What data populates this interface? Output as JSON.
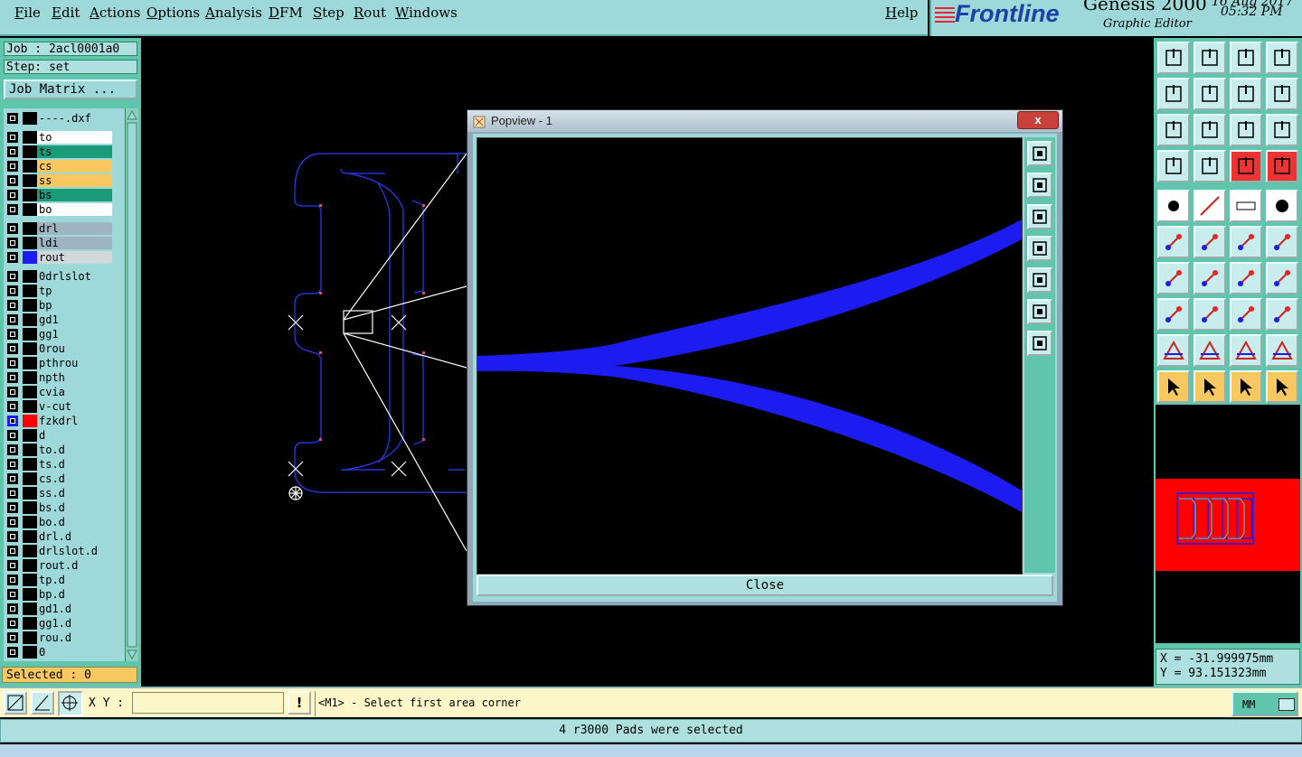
{
  "menu": {
    "items": [
      "File",
      "Edit",
      "Actions",
      "Options",
      "Analysis",
      "DFM",
      "Step",
      "Rout",
      "Windows"
    ],
    "help": "Help"
  },
  "brand": {
    "logo": "Frontline",
    "product": "Genesis 2000",
    "subtitle": "Graphic Editor",
    "date": "16 Aug 2017",
    "time": "05:32 PM"
  },
  "left": {
    "job": "Job : 2acl0001a0",
    "step": "Step: set",
    "job_matrix": "Job Matrix ...",
    "selected": "Selected : 0",
    "layers": [
      {
        "name": "----.dxf",
        "color": "#9fd8d8"
      },
      {
        "name": "to",
        "color": "#ffffff"
      },
      {
        "name": "ts",
        "color": "#1a9b7a"
      },
      {
        "name": "cs",
        "color": "#f8c860"
      },
      {
        "name": "ss",
        "color": "#f8c860"
      },
      {
        "name": "bs",
        "color": "#1a9b7a"
      },
      {
        "name": "bo",
        "color": "#ffffff"
      },
      {
        "name": "drl",
        "color": "#9eb4c0"
      },
      {
        "name": "ldi",
        "color": "#9eb4c0"
      },
      {
        "name": "rout",
        "color": "#d0d8dc"
      },
      {
        "name": "0drlslot",
        "color": "#9fd8d8"
      },
      {
        "name": "tp",
        "color": "#9fd8d8"
      },
      {
        "name": "bp",
        "color": "#9fd8d8"
      },
      {
        "name": "gd1",
        "color": "#9fd8d8"
      },
      {
        "name": "gg1",
        "color": "#9fd8d8"
      },
      {
        "name": "0rou",
        "color": "#9fd8d8"
      },
      {
        "name": "pthrou",
        "color": "#9fd8d8"
      },
      {
        "name": "npth",
        "color": "#9fd8d8"
      },
      {
        "name": "cvia",
        "color": "#9fd8d8"
      },
      {
        "name": "v-cut",
        "color": "#9fd8d8"
      },
      {
        "name": "fzkdrl",
        "color": "#9fd8d8"
      },
      {
        "name": "d",
        "color": "#9fd8d8"
      },
      {
        "name": "to.d",
        "color": "#9fd8d8"
      },
      {
        "name": "ts.d",
        "color": "#9fd8d8"
      },
      {
        "name": "cs.d",
        "color": "#9fd8d8"
      },
      {
        "name": "ss.d",
        "color": "#9fd8d8"
      },
      {
        "name": "bs.d",
        "color": "#9fd8d8"
      },
      {
        "name": "bo.d",
        "color": "#9fd8d8"
      },
      {
        "name": "drl.d",
        "color": "#9fd8d8"
      },
      {
        "name": "drlslot.d",
        "color": "#9fd8d8"
      },
      {
        "name": "rout.d",
        "color": "#9fd8d8"
      },
      {
        "name": "tp.d",
        "color": "#9fd8d8"
      },
      {
        "name": "bp.d",
        "color": "#9fd8d8"
      },
      {
        "name": "gd1.d",
        "color": "#9fd8d8"
      },
      {
        "name": "gg1.d",
        "color": "#9fd8d8"
      },
      {
        "name": "rou.d",
        "color": "#9fd8d8"
      },
      {
        "name": "0",
        "color": "#9fd8d8"
      }
    ]
  },
  "popup": {
    "title": "Popview - 1",
    "close_x": "x",
    "close_button": "Close"
  },
  "coords": {
    "x": "X  = -31.999975mm",
    "y": "Y  = 93.151323mm"
  },
  "command": {
    "xy_label": "X Y :",
    "xy_value": "",
    "prompt": "<M1> - Select first area corner",
    "units": "MM"
  },
  "status": "4 r3000 Pads were selected",
  "colors": {
    "panel": "#5fc6ad",
    "highlight_blue": "#1c1cf0",
    "overview_red": "#ff0000"
  }
}
